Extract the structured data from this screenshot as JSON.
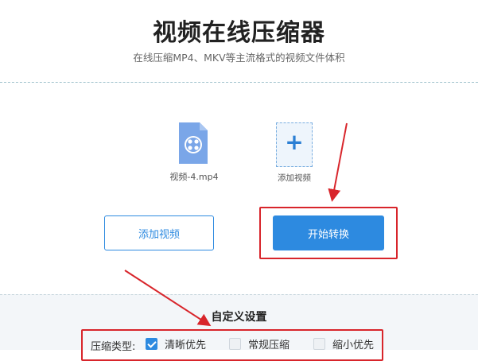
{
  "header": {
    "title": "视频在线压缩器",
    "subtitle": "在线压缩MP4、MKV等主流格式的视频文件体积"
  },
  "file": {
    "name": "视频-4.mp4",
    "icon": "video-file-icon"
  },
  "add_card": {
    "plus": "+",
    "label": "添加视频"
  },
  "buttons": {
    "add_video": "添加视频",
    "start_convert": "开始转换"
  },
  "settings": {
    "title": "自定义设置",
    "compression_type_label": "压缩类型:",
    "options": [
      {
        "label": "清晰优先",
        "checked": true
      },
      {
        "label": "常规压缩",
        "checked": false
      },
      {
        "label": "缩小优先",
        "checked": false
      }
    ]
  },
  "colors": {
    "accent": "#2d8ae0",
    "highlight": "#d8252b"
  }
}
